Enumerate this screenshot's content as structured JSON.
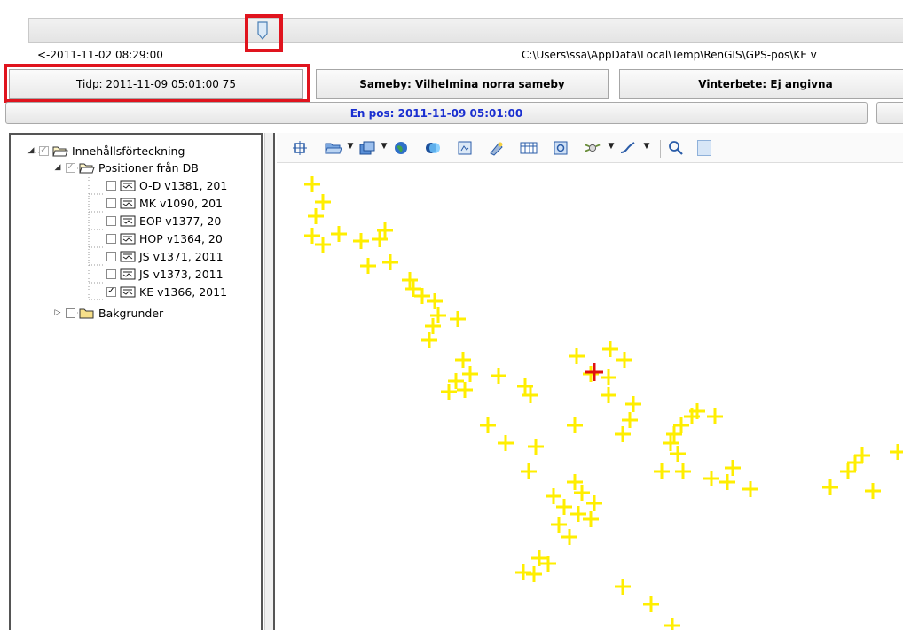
{
  "slider": {
    "time_start": "<-2011-11-02 08:29:00",
    "file_path": "C:\\Users\\ssa\\AppData\\Local\\Temp\\RenGIS\\GPS-pos\\KE v"
  },
  "status": {
    "time": "Tidp: 2011-11-09 05:01:00 75",
    "sameby": "Sameby: Vilhelmina norra sameby",
    "vinterbete": "Vinterbete: Ej angivna",
    "position": "En pos: 2011-11-09 05:01:00"
  },
  "tree": {
    "root": "Innehållsförteckning",
    "group": "Positioner från DB",
    "layers": [
      {
        "label": "O-D v1381, 201",
        "checked": false
      },
      {
        "label": "MK v1090, 201",
        "checked": false
      },
      {
        "label": "EOP v1377, 20",
        "checked": false
      },
      {
        "label": "HOP v1364, 20",
        "checked": false
      },
      {
        "label": "JS v1371, 2011",
        "checked": false
      },
      {
        "label": "JS v1373, 2011",
        "checked": false
      },
      {
        "label": "KE v1366, 2011",
        "checked": true
      }
    ],
    "background": "Bakgrunder"
  },
  "toolbar": {
    "tools": [
      "full-extent-icon",
      "open-folder-icon",
      "add-layer-icon",
      "globe-icon",
      "overlay-icon",
      "raster-icon",
      "identify-icon",
      "table-icon",
      "export-icon",
      "gps-icon",
      "draw-line-icon",
      "zoom-in-icon"
    ]
  },
  "map": {
    "colors": {
      "position": "#ffee00",
      "current": "#e01010",
      "highlight": "#e0141e"
    },
    "current_position_shown": true
  }
}
